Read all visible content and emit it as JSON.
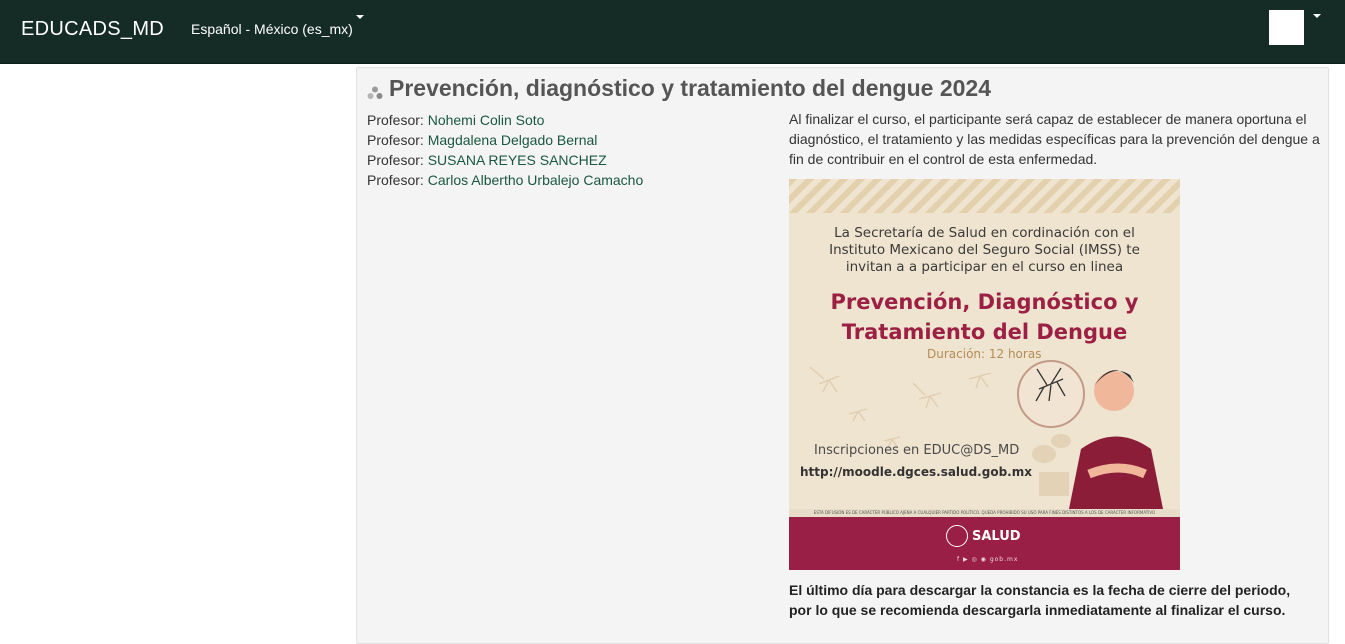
{
  "navbar": {
    "brand": "EDUCADS_MD",
    "language": "Español - México (es_mx)"
  },
  "course": {
    "title": "Prevención, diagnóstico y tratamiento del dengue 2024",
    "teacher_role": "Profesor:",
    "teachers": [
      "Nohemi Colin Soto",
      "Magdalena Delgado Bernal",
      "SUSANA REYES SANCHEZ",
      "Carlos Albertho Urbalejo Camacho"
    ],
    "summary": "Al finalizar el curso, el participante será capaz de establecer de manera oportuna el diagnóstico, el tratamiento y las medidas específicas para la prevención del dengue a fin de contribuir en el control de esta enfermedad.",
    "poster": {
      "intro_lines": [
        "La Secretaría de Salud en cordinación con el",
        "Instituto Mexicano del Seguro Social (IMSS) te",
        "invitan a a participar en el curso en linea"
      ],
      "title_lines": [
        "Prevención, Diagnóstico y",
        "Tratamiento del Dengue"
      ],
      "duration": "Duración: 12 horas",
      "registration": "Inscripciones en EDUC@DS_MD",
      "url": "http://moodle.dgces.salud.gob.mx",
      "disclaimer": "ESTA DIFUSIÓN ES DE CARÁCTER PÚBLICO AJENA A CUALQUIER PARTIDO POLÍTICO. QUEDA PROHIBIDO SU USO PARA FINES DISTINTOS A LOS DE CARÁCTER INFORMATIVO",
      "logo": "SALUD",
      "social": "f ▶ ◎ ◉ gob.mx"
    },
    "deadline_lines": [
      "El último día para descargar la constancia es la fecha de cierre del periodo,",
      "por lo que se recomienda descargarla inmediatamente al finalizar el curso."
    ]
  },
  "colors": {
    "navbar": "#152c26",
    "link": "#1a5740",
    "poster_accent": "#9c1f44"
  },
  "icons": {
    "course": "course-icon",
    "avatar": "user-avatar",
    "dropdown": "caret-down-icon"
  }
}
